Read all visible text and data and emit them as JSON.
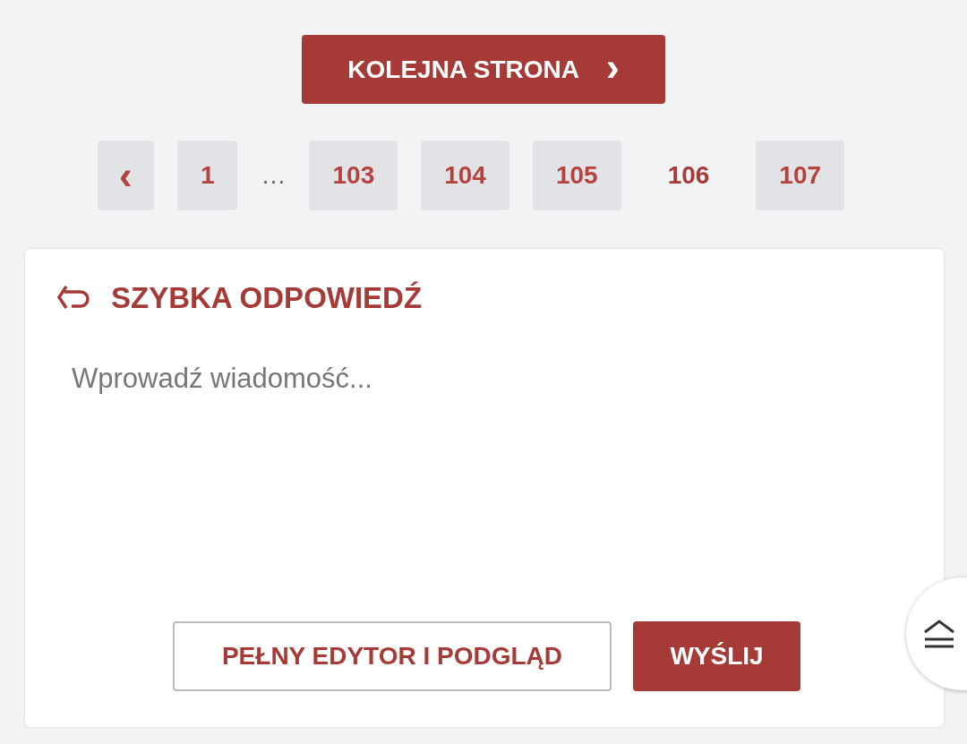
{
  "next_button": {
    "label": "KOLEJNA STRONA",
    "icon": "›"
  },
  "pagination": [
    {
      "kind": "prev",
      "label": "‹"
    },
    {
      "kind": "page",
      "label": "1",
      "selected": false
    },
    {
      "kind": "ellipsis",
      "label": "…"
    },
    {
      "kind": "page",
      "label": "103",
      "selected": false
    },
    {
      "kind": "page",
      "label": "104",
      "selected": false
    },
    {
      "kind": "page",
      "label": "105",
      "selected": false
    },
    {
      "kind": "page",
      "label": "106",
      "selected": true
    },
    {
      "kind": "page",
      "label": "107",
      "selected": false
    }
  ],
  "quick_reply": {
    "title": "SZYBKA ODPOWIEDŹ",
    "placeholder": "Wprowadź wiadomość...",
    "buttons": [
      {
        "kind": "outline",
        "label": "PEŁNY EDYTOR I PODGLĄD"
      },
      {
        "kind": "primary",
        "label": "WYŚLIJ"
      }
    ]
  }
}
